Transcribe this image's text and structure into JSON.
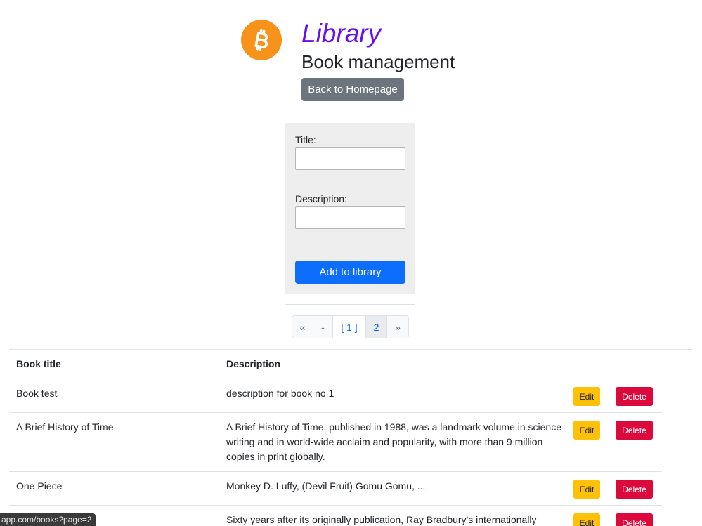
{
  "header": {
    "title": "Library",
    "subtitle": "Book management",
    "back_button": "Back to Homepage",
    "logo_icon": "bitcoin-icon",
    "title_color": "#6610f2"
  },
  "form": {
    "title_label": "Title:",
    "title_value": "",
    "description_label": "Description:",
    "description_value": "",
    "submit_label": "Add to library"
  },
  "pagination": {
    "items": [
      "«",
      "-",
      "[ 1 ]",
      "2",
      "»"
    ],
    "active": "2"
  },
  "table": {
    "headers": [
      "Book title",
      "Description"
    ],
    "rows": [
      {
        "title": "Book test",
        "description": "description for book no 1",
        "edit": "Edit",
        "delete": "Delete"
      },
      {
        "title": "A Brief History of Time",
        "description": "A Brief History of Time, published in 1988, was a landmark volume in science writing and in world-wide acclaim and popularity, with more than 9 million copies in print globally.",
        "edit": "Edit",
        "delete": "Delete"
      },
      {
        "title": "One Piece",
        "description": "Monkey D. Luffy, (Devil Fruit) Gomu Gomu, ...",
        "edit": "Edit",
        "delete": "Delete"
      },
      {
        "title": "",
        "description": "Sixty years after its originally publication, Ray Bradbury's internationally",
        "edit": "Edit",
        "delete": "Delete"
      }
    ]
  },
  "status_bar": {
    "url": "app.com/books?page=2"
  },
  "colors": {
    "primary": "#0d6efd",
    "secondary": "#6c757d",
    "warning": "#ffc107",
    "danger": "#dc0a3c",
    "bitcoin": "#f7931a"
  }
}
